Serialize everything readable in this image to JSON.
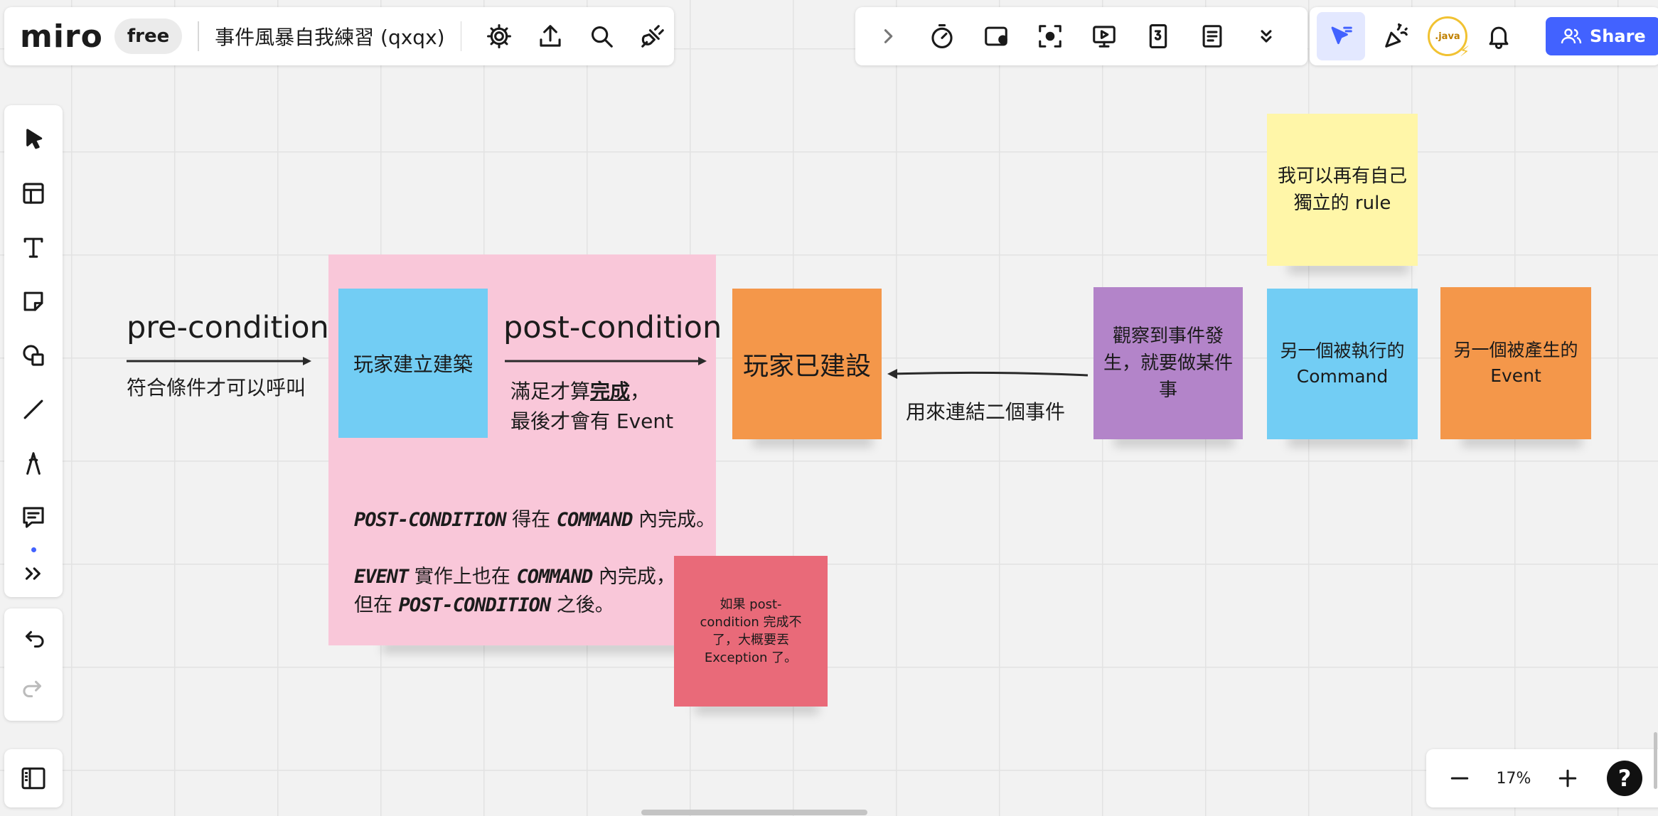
{
  "app": {
    "logo_text": "miro",
    "plan_badge": "free",
    "board_title": "事件風暴自我練習 (qxqx)"
  },
  "top_tools": [
    "settings-icon",
    "export-icon",
    "search-icon",
    "plugin-icon"
  ],
  "collab_tools": [
    "chevron-right-icon",
    "timer-icon",
    "video-icon",
    "focus-icon",
    "present-icon",
    "numbered-icon",
    "notes-icon",
    "more-icon"
  ],
  "right_bar": {
    "avatar_label": ".java",
    "share_label": "Share",
    "accent": "#4262ff"
  },
  "left_tools": [
    "select-icon",
    "templates-icon",
    "text-icon",
    "sticky-note-icon",
    "shapes-icon",
    "line-icon",
    "pen-icon",
    "comment-icon",
    "more-tools-icon"
  ],
  "zoom": {
    "value": "17%",
    "help": "?"
  },
  "canvas": {
    "pre_condition": {
      "title": "pre-condition",
      "desc": "符合條件才可以呼叫"
    },
    "post_condition": {
      "title": "post-condition",
      "desc_prefix": "滿足才算",
      "desc_bold": "完成",
      "desc_suffix": "，",
      "desc_line2": "最後才會有 Event"
    },
    "frame_note": {
      "l1_a": "POST-CONDITION",
      "l1_b": " 得在 ",
      "l1_c": "COMMAND",
      "l1_d": " 內完成。",
      "l2_a": "EVENT",
      "l2_b": " 實作上也在 ",
      "l2_c": "COMMAND",
      "l2_d": " 內完成，",
      "l3_a": "但在 ",
      "l3_b": "POST-CONDITION",
      "l3_c": " 之後。"
    },
    "link_label": "用來連結二個事件",
    "stickies": {
      "command": "玩家建立建築",
      "event": "玩家已建設",
      "exception": "如果 post-condition 完成不了，大概要丟 Exception 了。",
      "policy": "觀察到事件發生，就要做某件事",
      "command2": "另一個被執行的 Command",
      "event2": "另一個被產生的 Event",
      "rule": "我可以再有自己獨立的 rule"
    },
    "colors": {
      "blue": "#72cdf4",
      "orange": "#f4974a",
      "purple": "#b384c9",
      "yellow": "#fff6a8",
      "red": "#e96a79",
      "pink_frame": "#f9c7d9"
    }
  }
}
